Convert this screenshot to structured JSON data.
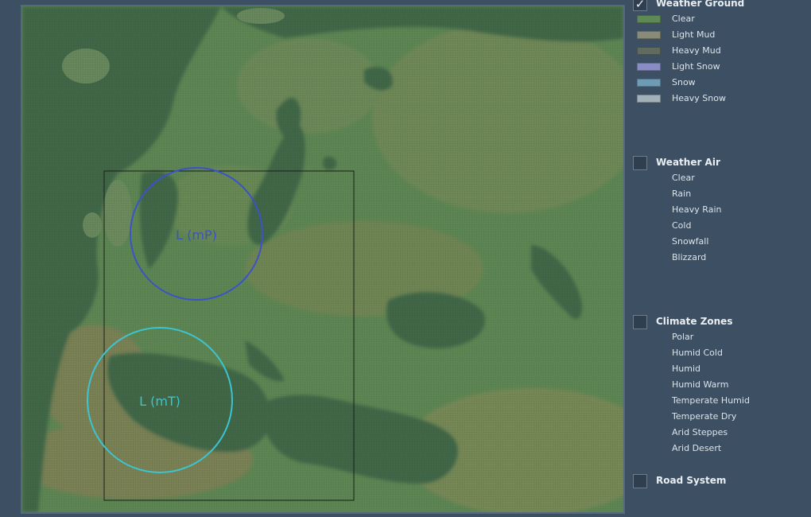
{
  "map": {
    "systems": [
      {
        "label": "L (mP)",
        "color": "#3c52c8"
      },
      {
        "label": "L (mT)",
        "color": "#3cc4d0"
      }
    ]
  },
  "legend": {
    "weather_ground": {
      "title": "Weather Ground",
      "checked": true,
      "check_mark": "✓",
      "items": [
        {
          "label": "Clear",
          "color": "#5e8a56"
        },
        {
          "label": "Light Mud",
          "color": "#8a8a78"
        },
        {
          "label": "Heavy Mud",
          "color": "#5f6a60"
        },
        {
          "label": "Light Snow",
          "color": "#8a8cc4"
        },
        {
          "label": "Snow",
          "color": "#6e9cb4"
        },
        {
          "label": "Heavy Snow",
          "color": "#a2b0b8"
        }
      ]
    },
    "weather_air": {
      "title": "Weather Air",
      "checked": false,
      "items": [
        {
          "label": "Clear"
        },
        {
          "label": "Rain"
        },
        {
          "label": "Heavy Rain"
        },
        {
          "label": "Cold"
        },
        {
          "label": "Snowfall"
        },
        {
          "label": "Blizzard"
        }
      ]
    },
    "climate_zones": {
      "title": "Climate Zones",
      "checked": false,
      "items": [
        {
          "label": "Polar"
        },
        {
          "label": "Humid Cold"
        },
        {
          "label": "Humid"
        },
        {
          "label": "Humid Warm"
        },
        {
          "label": "Temperate Humid"
        },
        {
          "label": "Temperate Dry"
        },
        {
          "label": "Arid Steppes"
        },
        {
          "label": "Arid Desert"
        }
      ]
    },
    "road_system": {
      "title": "Road System",
      "checked": false
    }
  }
}
